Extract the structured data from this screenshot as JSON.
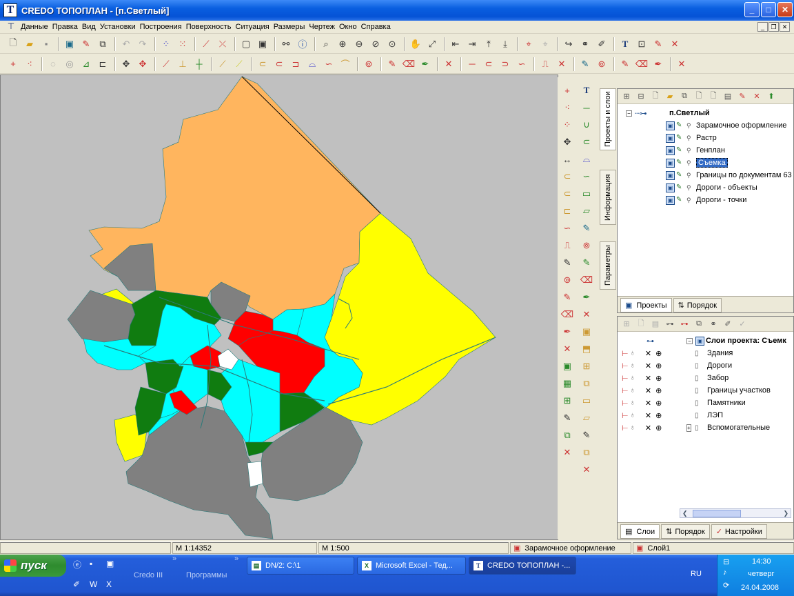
{
  "window": {
    "title": "CREDO ТОПОПЛАН - [п.Светлый]",
    "app_icon": "T"
  },
  "menu": [
    "Данные",
    "Правка",
    "Вид",
    "Установки",
    "Построения",
    "Поверхность",
    "Ситуация",
    "Размеры",
    "Чертеж",
    "Окно",
    "Справка"
  ],
  "toolbar_text_glyph": "T",
  "side_tabs": [
    "Проекты и слои",
    "Информация",
    "Параметры"
  ],
  "projects_panel": {
    "root": "п.Светлый",
    "layers": [
      "Зарамочное оформление",
      "Растр",
      "Генплан",
      "Съемка",
      "Границы по документам 63",
      "Дороги - объекты",
      "Дороги - точки"
    ],
    "selected_index": 3,
    "tabs": [
      "Проекты",
      "Порядок"
    ]
  },
  "layers_panel": {
    "root": "Слои проекта: Съемк",
    "items": [
      "Здания",
      "Дороги",
      "Забор",
      "Границы участков",
      "Памятники",
      "ЛЭП",
      "Вспомогательные"
    ],
    "tabs": [
      "Слои",
      "Порядок",
      "Настройки"
    ]
  },
  "status": {
    "scale1": "М 1:14352",
    "scale2": "М 1:500",
    "frame": "Зарамочное оформление",
    "layer": "Слой1"
  },
  "taskbar": {
    "start": "пуск",
    "labels": [
      "Credo III",
      "Программы"
    ],
    "tasks": [
      "DN/2: C:\\1",
      "Microsoft Excel - Тед...",
      "CREDO ТОПОПЛАН -..."
    ],
    "lang": "RU",
    "time": "14:30",
    "day": "четверг",
    "date": "24.04.2008"
  },
  "map_colors": {
    "orange": "#ffb55e",
    "yellow": "#ffff00",
    "gray": "#808080",
    "green": "#107c10",
    "cyan": "#00ffff",
    "red": "#ff0000",
    "background": "#c0c0c0"
  }
}
